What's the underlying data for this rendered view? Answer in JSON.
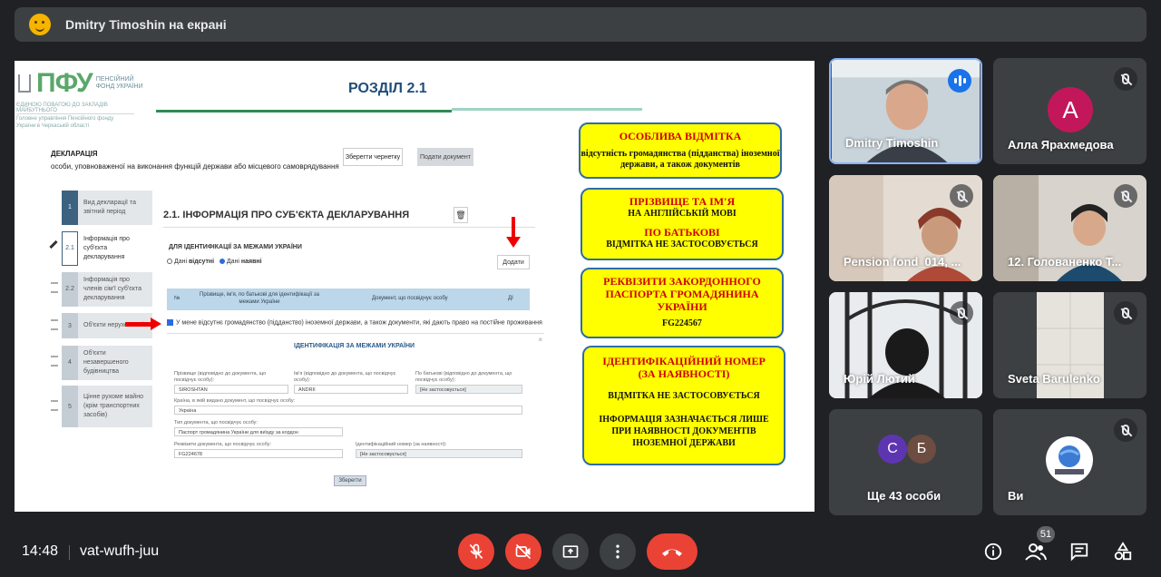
{
  "banner": {
    "title": "Dmitry Timoshin на екрані"
  },
  "slide": {
    "logo": {
      "brand": "ПФУ",
      "sub": "ПЕНСІЙНИЙ ФОНД УКРАЇНИ",
      "line1": "ЄДИНОЮ ПОВАГОЮ ДО ЗАКЛАДІВ МАЙБУТНЬОГО",
      "line2": "Головне управління Пенсійного фонду України в Черкаській області"
    },
    "heading": "РОЗДІЛ 2.1",
    "decl_title": "ДЕКЛАРАЦІЯ",
    "decl_sub": "особи, уповноваженої на виконання функцій держави або місцевого самоврядування",
    "save_draft": "Зберегти чернетку",
    "submit_doc": "Подати документ",
    "steps": [
      {
        "num": "1",
        "label": "Вид декларації та звітний період"
      },
      {
        "num": "2.1",
        "label": "Інформація про суб'єкта декларування"
      },
      {
        "num": "2.2",
        "label": "Інформація про членів сім'ї суб'єкта декларування"
      },
      {
        "num": "3",
        "label": "Об'єкти нерухомості"
      },
      {
        "num": "4",
        "label": "Об'єкти незавершеного будівництва"
      },
      {
        "num": "5",
        "label": "Цінне рухоме майно (крім транспортних засобів)"
      }
    ],
    "section_title": "2.1.  ІНФОРМАЦІЯ ПРО СУБ'ЄКТА ДЕКЛАРУВАННЯ",
    "ident_heading": "ДЛЯ ІДЕНТИФІКАЦІЇ ЗА МЕЖАМИ УКРАЇНИ",
    "radio_absent_prefix": "Дані ",
    "radio_absent": "відсутні",
    "radio_present_prefix": "Дані ",
    "radio_present": "наявні",
    "add_button": "Додати",
    "table_headers": {
      "no": "№",
      "name": "Прізвище, ім'я, по батькові для ідентифікації за межами України",
      "doc": "Документ, що посвідчує особу",
      "actions": "ДІ"
    },
    "checkbox_text": "У мене відсутнє громадянство (підданство) іноземної держави, а також документи, які дають право на постійне проживання",
    "modal": {
      "title": "ІДЕНТИФІКАЦІЯ ЗА МЕЖАМИ УКРАЇНИ",
      "close": "×",
      "surname_label": "Прізвище (відповідно до документа, що посвідчує особу):",
      "surname_value": "SIROSHTAN",
      "name_label": "Ім'я (відповідно до документа, що посвідчує особу):",
      "name_value": "ANDRII",
      "patronymic_label": "По батькові (відповідно до документа, що посвідчує особу):",
      "patronymic_value": "[Не застосовується]",
      "country_label": "Країна, в якій видано документ, що посвідчує особу:",
      "country_value": "Україна",
      "doctype_label": "Тип документа, що посвідчує особу:",
      "doctype_value": "Паспорт громадянина України для виїзду за кордон",
      "docnum_label": "Реквізити документа, що посвідчує особу:",
      "docnum_value": "FG224678",
      "idnum_label": "Ідентифікаційний номер (за наявності):",
      "idnum_value": "[Не застосовується]",
      "save": "Зберегти"
    },
    "boxes": [
      {
        "red": "ОСОБЛИВА ВІДМІТКА",
        "black": "відсутність громадянства (підданства) іноземної держави, а також документів"
      },
      {
        "red": "ПРІЗВИЩЕ ТА ІМ'Я",
        "black": "НА АНГЛІЙСЬКІЙ МОВІ",
        "red2": "ПО БАТЬКОВІ",
        "black2": "ВІДМІТКА НЕ ЗАСТОСОВУЄТЬСЯ"
      },
      {
        "red": "РЕКВІЗИТИ ЗАКОРДОННОГО ПАСПОРТА ГРОМАДЯНИНА УКРАЇНИ",
        "black": "FG224567"
      },
      {
        "red": "ІДЕНТИФІКАЦІЙНИЙ НОМЕР (ЗА НАЯВНОСТІ)",
        "black": "ВІДМІТКА НЕ ЗАСТОСОВУЄТЬСЯ",
        "black2": "ІНФОРМАЦІЯ ЗАЗНАЧАЄТЬСЯ ЛИШЕ ПРИ НАЯВНОСТІ ДОКУМЕНТІВ ІНОЗЕМНОЇ ДЕРЖАВИ"
      }
    ]
  },
  "participants": [
    {
      "name": "Dmitry Timoshin",
      "state": "speaking"
    },
    {
      "name": "Алла Ярахмедова",
      "avatar_letter": "А",
      "state": "muted"
    },
    {
      "name": "Pension fond_014, ...",
      "state": "muted"
    },
    {
      "name": "12. Голованенко Т...",
      "state": "muted"
    },
    {
      "name": "Юрій Лютий",
      "state": "muted"
    },
    {
      "name": "Sveta Barulenko",
      "state": "muted"
    },
    {
      "name": "Ще 43 особи",
      "avatars": [
        "С",
        "Б"
      ]
    },
    {
      "name": "Ви",
      "state": "muted"
    }
  ],
  "bottom": {
    "time": "14:48",
    "meeting_code": "vat-wufh-juu",
    "people_count": "51"
  },
  "colors": {
    "bg": "#202124",
    "tile": "#3c4043",
    "red": "#ea4335",
    "blue": "#1a73e8"
  }
}
